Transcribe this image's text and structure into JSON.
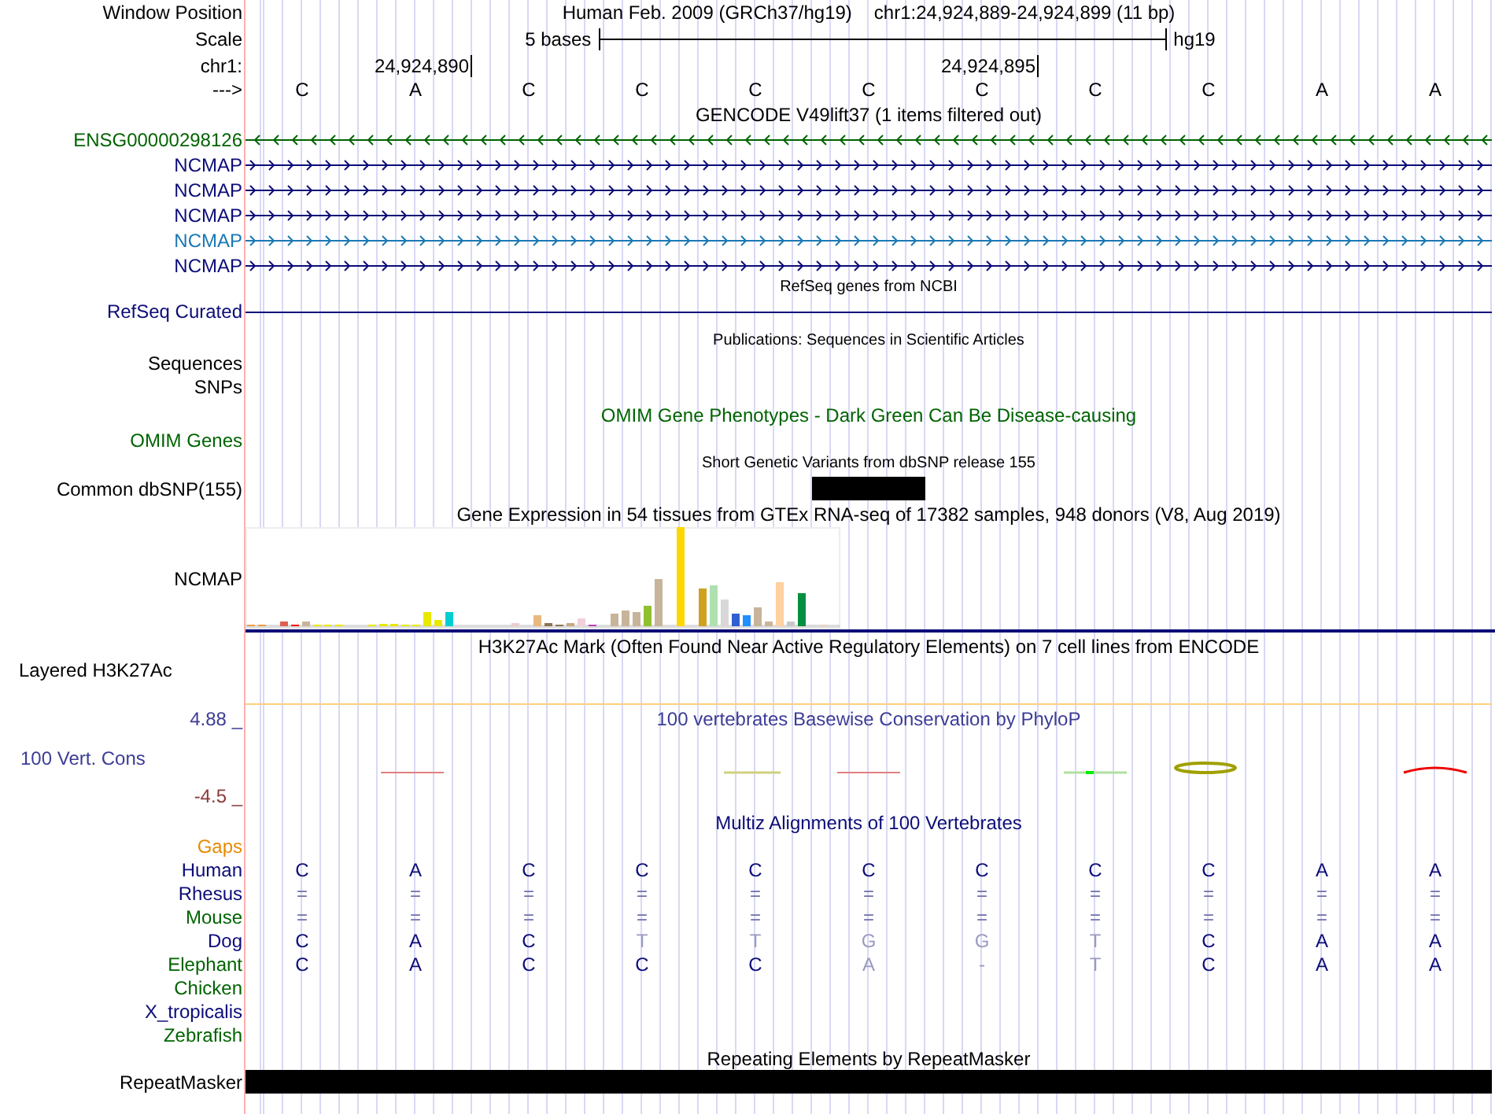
{
  "header": {
    "window_position_label": "Window Position",
    "scale_label": "Scale",
    "chr_label": "chr1:",
    "strand_label": "--->",
    "assembly": "Human Feb. 2009 (GRCh37/hg19)",
    "position": "chr1:24,924,889-24,924,899 (11 bp)",
    "scale_text": "5 bases",
    "scale_db": "hg19"
  },
  "bases": [
    {
      "letter": "C"
    },
    {
      "letter": "A",
      "tick": "24,924,890"
    },
    {
      "letter": "C"
    },
    {
      "letter": "C"
    },
    {
      "letter": "C"
    },
    {
      "letter": "C"
    },
    {
      "letter": "C",
      "tick": "24,924,895"
    },
    {
      "letter": "C"
    },
    {
      "letter": "C"
    },
    {
      "letter": "A"
    },
    {
      "letter": "A"
    }
  ],
  "tracks": [
    {
      "kind": "gene",
      "title": {
        "text": "GENCODE V49lift37 (1 items filtered out)",
        "color": "#000000"
      },
      "items": [
        {
          "label": "ENSG00000298126",
          "kind": "reverse",
          "color": "#006400"
        },
        {
          "label": "NCMAP",
          "kind": "forward",
          "color": "#0c0c78"
        },
        {
          "label": "NCMAP",
          "kind": "forward",
          "color": "#0c0c78"
        },
        {
          "label": "NCMAP",
          "kind": "forward",
          "color": "#0c0c78"
        },
        {
          "label": "NCMAP",
          "kind": "forward",
          "color": "#1a78b4"
        },
        {
          "label": "NCMAP",
          "kind": "forward",
          "color": "#0c0c78"
        }
      ]
    },
    {
      "kind": "line",
      "title": {
        "text": "RefSeq genes from NCBI",
        "color": "#000000"
      },
      "label": "RefSeq Curated",
      "color": "#0c0c78"
    },
    {
      "kind": "labels",
      "title": {
        "text": "Publications: Sequences in Scientific Articles",
        "color": "#000000"
      },
      "labels": [
        "Sequences",
        "SNPs"
      ],
      "color": "#000000"
    },
    {
      "kind": "empty",
      "title": {
        "text": "OMIM Gene Phenotypes - Dark Green Can Be Disease-causing",
        "color": "#006400"
      },
      "label": "OMIM Genes",
      "color": "#006400"
    },
    {
      "kind": "variant",
      "title": {
        "text": "Short Genetic Variants from dbSNP release 155",
        "color": "#000000"
      },
      "label": "Common dbSNP(155)",
      "color": "#000000",
      "cells": [
        {
          "filled": false
        },
        {
          "filled": false
        },
        {
          "filled": false
        },
        {
          "filled": false
        },
        {
          "filled": false
        },
        {
          "filled": true
        },
        {
          "filled": false
        },
        {
          "filled": false
        },
        {
          "filled": false
        },
        {
          "filled": false
        },
        {
          "filled": false
        }
      ]
    },
    {
      "kind": "expression",
      "title": {
        "text": "Gene Expression in 54 tissues from GTEx RNA-seq of 17382 samples, 948 donors (V8, Aug 2019)",
        "color": "#000000"
      },
      "label": "NCMAP",
      "color": "#000000"
    },
    {
      "kind": "signal",
      "title": {
        "text": "H3K27Ac Mark (Often Found Near Active Regulatory Elements) on 7 cell lines from ENCODE",
        "color": "#000000"
      },
      "label": "Layered H3K27Ac",
      "color": "#000000"
    },
    {
      "kind": "conservation",
      "title": {
        "text": "100 vertebrates Basewise Conservation by PhyloP",
        "color": "#3c3c96"
      },
      "label": "100 Vert. Cons",
      "color": "#3c3c96",
      "max": "4.88 _",
      "min": "-4.5 _"
    },
    {
      "kind": "alignment",
      "title": {
        "text": "Multiz Alignments of 100 Vertebrates",
        "color": "#0c0c78"
      },
      "gaps_label": "Gaps",
      "species": [
        {
          "name": "Human",
          "color": "#0c0c78",
          "bases": [
            {
              "text": "C",
              "kind": "base"
            },
            {
              "text": "A",
              "kind": "base"
            },
            {
              "text": "C",
              "kind": "base"
            },
            {
              "text": "C",
              "kind": "base"
            },
            {
              "text": "C",
              "kind": "base"
            },
            {
              "text": "C",
              "kind": "base"
            },
            {
              "text": "C",
              "kind": "base"
            },
            {
              "text": "C",
              "kind": "base"
            },
            {
              "text": "C",
              "kind": "base"
            },
            {
              "text": "A",
              "kind": "base"
            },
            {
              "text": "A",
              "kind": "base"
            }
          ]
        },
        {
          "name": "Rhesus",
          "color": "#0c0c78",
          "bases": [
            {
              "text": "=",
              "kind": "same"
            },
            {
              "text": "=",
              "kind": "same"
            },
            {
              "text": "=",
              "kind": "same"
            },
            {
              "text": "=",
              "kind": "same"
            },
            {
              "text": "=",
              "kind": "same"
            },
            {
              "text": "=",
              "kind": "same"
            },
            {
              "text": "=",
              "kind": "same"
            },
            {
              "text": "=",
              "kind": "same"
            },
            {
              "text": "=",
              "kind": "same"
            },
            {
              "text": "=",
              "kind": "same"
            },
            {
              "text": "=",
              "kind": "same"
            }
          ]
        },
        {
          "name": "Mouse",
          "color": "#006400",
          "bases": [
            {
              "text": "=",
              "kind": "same"
            },
            {
              "text": "=",
              "kind": "same"
            },
            {
              "text": "=",
              "kind": "same"
            },
            {
              "text": "=",
              "kind": "same"
            },
            {
              "text": "=",
              "kind": "same"
            },
            {
              "text": "=",
              "kind": "same"
            },
            {
              "text": "=",
              "kind": "same"
            },
            {
              "text": "=",
              "kind": "same"
            },
            {
              "text": "=",
              "kind": "same"
            },
            {
              "text": "=",
              "kind": "same"
            },
            {
              "text": "=",
              "kind": "same"
            }
          ]
        },
        {
          "name": "Dog",
          "color": "#0c0c78",
          "bases": [
            {
              "text": "C",
              "kind": "base"
            },
            {
              "text": "A",
              "kind": "base"
            },
            {
              "text": "C",
              "kind": "base"
            },
            {
              "text": "T",
              "kind": "diff"
            },
            {
              "text": "T",
              "kind": "diff"
            },
            {
              "text": "G",
              "kind": "diff"
            },
            {
              "text": "G",
              "kind": "diff"
            },
            {
              "text": "T",
              "kind": "diff"
            },
            {
              "text": "C",
              "kind": "base"
            },
            {
              "text": "A",
              "kind": "base"
            },
            {
              "text": "A",
              "kind": "base"
            }
          ]
        },
        {
          "name": "Elephant",
          "color": "#006400",
          "bases": [
            {
              "text": "C",
              "kind": "base"
            },
            {
              "text": "A",
              "kind": "base"
            },
            {
              "text": "C",
              "kind": "base"
            },
            {
              "text": "C",
              "kind": "base"
            },
            {
              "text": "C",
              "kind": "base"
            },
            {
              "text": "A",
              "kind": "diff"
            },
            {
              "text": "-",
              "kind": "diff"
            },
            {
              "text": "T",
              "kind": "diff"
            },
            {
              "text": "C",
              "kind": "base"
            },
            {
              "text": "A",
              "kind": "base"
            },
            {
              "text": "A",
              "kind": "base"
            }
          ]
        },
        {
          "name": "Chicken",
          "color": "#006400"
        },
        {
          "name": "X_tropicalis",
          "color": "#0c0c78"
        },
        {
          "name": "Zebrafish",
          "color": "#006400"
        }
      ]
    },
    {
      "kind": "repeat",
      "title": {
        "text": "Repeating Elements by RepeatMasker",
        "color": "#000000"
      },
      "label": "RepeatMasker",
      "color": "#000000"
    }
  ]
}
